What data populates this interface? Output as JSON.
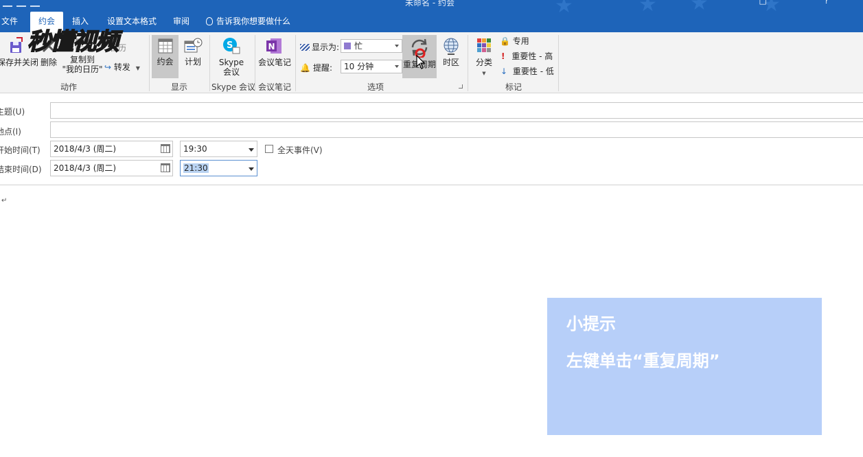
{
  "window": {
    "title": "未命名 - 约会"
  },
  "tabs": [
    {
      "label": "文件"
    },
    {
      "label": "约会"
    },
    {
      "label": "插入"
    },
    {
      "label": "设置文本格式"
    },
    {
      "label": "审阅"
    }
  ],
  "tell_me": "告诉我你想要做什么",
  "logo_text": "秒懂视频",
  "ribbon": {
    "actions": {
      "save_close": "保存并关闭",
      "delete": "删除",
      "copy_to_line1": "复制到",
      "copy_to_line2": "\"我的日历\"",
      "calendar_small": "日历",
      "forward": "转发",
      "group_label": "动作"
    },
    "show": {
      "appointment": "约会",
      "schedule": "计划",
      "group_label": "显示"
    },
    "skype": {
      "line1": "Skype",
      "line2": "会议",
      "group_label": "Skype 会议"
    },
    "meeting_notes": {
      "label": "会议笔记",
      "group_label": "会议笔记"
    },
    "options": {
      "show_as_label": "显示为:",
      "show_as_value": "忙",
      "reminder_label": "提醒:",
      "reminder_value": "10 分钟",
      "recurrence": "重复周期",
      "time_zone": "时区",
      "group_label": "选项"
    },
    "tags": {
      "categorize": "分类",
      "private": "专用",
      "high_importance": "重要性 - 高",
      "low_importance": "重要性 - 低",
      "group_label": "标记"
    }
  },
  "form": {
    "subject_label": "主题(U)",
    "location_label": "地点(I)",
    "start_label": "开始时间(T)",
    "end_label": "结束时间(D)",
    "start_date": "2018/4/3 (周二)",
    "start_time": "19:30",
    "end_date": "2018/4/3 (周二)",
    "end_time": "21:30",
    "all_day": "全天事件(V)"
  },
  "body_mark": "↵",
  "tip": {
    "title": "小提示",
    "text": "左键单击“重复周期”"
  },
  "colors": {
    "brand": "#1e64b9",
    "tip_bg": "#b7cff9",
    "show_as_swatch": "#8f7ad0",
    "onenote": "#7b35a9"
  }
}
